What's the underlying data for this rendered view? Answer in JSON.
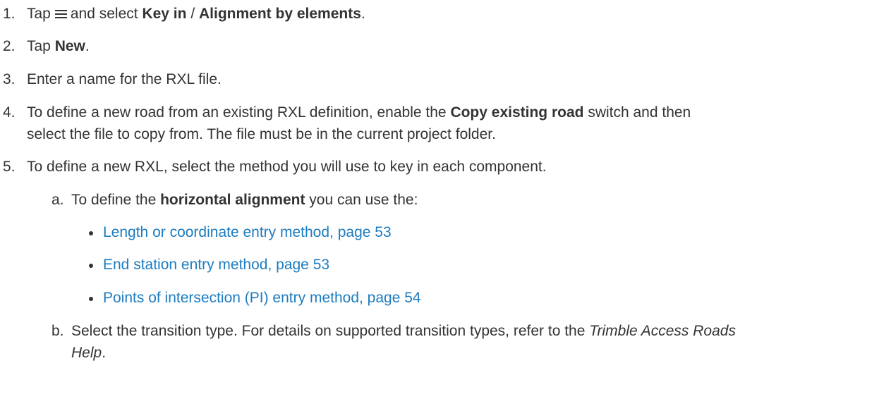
{
  "steps": [
    {
      "num": "1.",
      "pre": "Tap",
      "post": "and select",
      "bold1": "Key in",
      "sep": "/",
      "bold2": "Alignment by elements",
      "end": "."
    },
    {
      "num": "2.",
      "pre": "Tap",
      "bold": "New",
      "end": "."
    },
    {
      "num": "3.",
      "text": "Enter a name for the RXL file."
    },
    {
      "num": "4.",
      "pre": "To define a new road from an existing RXL definition, enable the",
      "bold": "Copy existing road",
      "post": "switch and then",
      "line2": "select the file to copy from. The file must be in the current project folder."
    },
    {
      "num": "5.",
      "text": "To define a new RXL, select the method you will use to key in each component."
    }
  ],
  "substeps": [
    {
      "num": "a.",
      "pre": "To define the",
      "bold": "horizontal alignment",
      "post": "you can use the:"
    },
    {
      "num": "b.",
      "pre": "Select the transition type. For details on supported transition types, refer to the",
      "italic": "Trimble Access Roads",
      "italic2": "Help",
      "end": "."
    }
  ],
  "links": [
    "Length or coordinate entry method, page 53",
    "End station entry method, page 53",
    "Points of intersection (PI) entry method, page 54"
  ],
  "icons": {
    "menu": "menu-icon"
  },
  "colors": {
    "text": "#333333",
    "link": "#1c7cc0"
  }
}
